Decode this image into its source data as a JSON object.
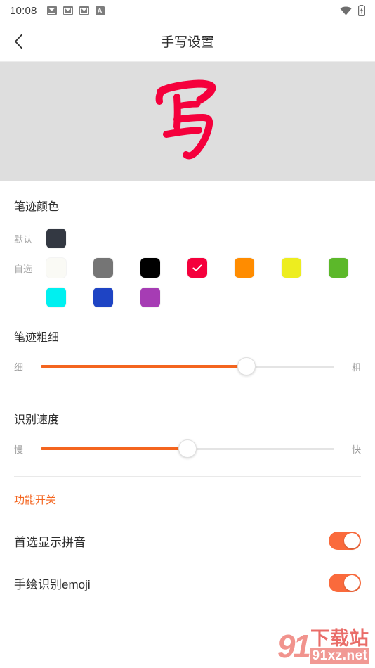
{
  "statusbar": {
    "time": "10:08",
    "left_icons": [
      {
        "name": "mail-icon-1",
        "glyph": "mail"
      },
      {
        "name": "mail-icon-2",
        "glyph": "mail"
      },
      {
        "name": "mail-icon-3",
        "glyph": "mail"
      },
      {
        "name": "app-badge-icon",
        "glyph": "A",
        "label": "A"
      }
    ],
    "right_icons": [
      {
        "name": "wifi-icon",
        "glyph": "wifi"
      },
      {
        "name": "battery-charging-icon",
        "glyph": "battery-bolt"
      }
    ]
  },
  "titlebar": {
    "back_icon": "chevron-left-icon",
    "title": "手写设置"
  },
  "preview": {
    "character": "写",
    "ink_color": "#F5003C",
    "background": "#DEDEDE"
  },
  "ink_color": {
    "section_title": "笔迹颜色",
    "default_label": "默认",
    "custom_label": "自选",
    "default_swatch": {
      "name": "swatch-default-charcoal",
      "color": "#333842",
      "selected": false
    },
    "custom_swatches_row1": [
      {
        "name": "swatch-white",
        "color": "#FAFAF5",
        "selected": false
      },
      {
        "name": "swatch-gray",
        "color": "#757575",
        "selected": false
      },
      {
        "name": "swatch-black",
        "color": "#000000",
        "selected": false
      },
      {
        "name": "swatch-crimson",
        "color": "#F5003C",
        "selected": true
      },
      {
        "name": "swatch-orange",
        "color": "#FF8C00",
        "selected": false
      },
      {
        "name": "swatch-yellow",
        "color": "#EDED1F",
        "selected": false
      },
      {
        "name": "swatch-green",
        "color": "#5CB82A",
        "selected": false
      }
    ],
    "custom_swatches_row2": [
      {
        "name": "swatch-cyan",
        "color": "#00F0F0",
        "selected": false
      },
      {
        "name": "swatch-blue",
        "color": "#1E44C4",
        "selected": false
      },
      {
        "name": "swatch-purple",
        "color": "#A63CB4",
        "selected": false
      }
    ]
  },
  "stroke_width": {
    "section_title": "笔迹粗细",
    "min_label": "细",
    "max_label": "粗",
    "value_percent": 70,
    "fill_color": "#F4651F"
  },
  "recognition_speed": {
    "section_title": "识别速度",
    "min_label": "慢",
    "max_label": "快",
    "value_percent": 50,
    "fill_color": "#F4651F"
  },
  "feature_switches": {
    "section_title": "功能开关",
    "accent_color": "#F4651F",
    "items": [
      {
        "name": "switch-show-pinyin",
        "label": "首选显示拼音",
        "state": "on"
      },
      {
        "name": "switch-emoji-recognition",
        "label": "手绘识别emoji",
        "state": "on"
      }
    ]
  },
  "watermark": {
    "logo": "91",
    "site_cn": "下载站",
    "site_url": "91xz.net"
  }
}
